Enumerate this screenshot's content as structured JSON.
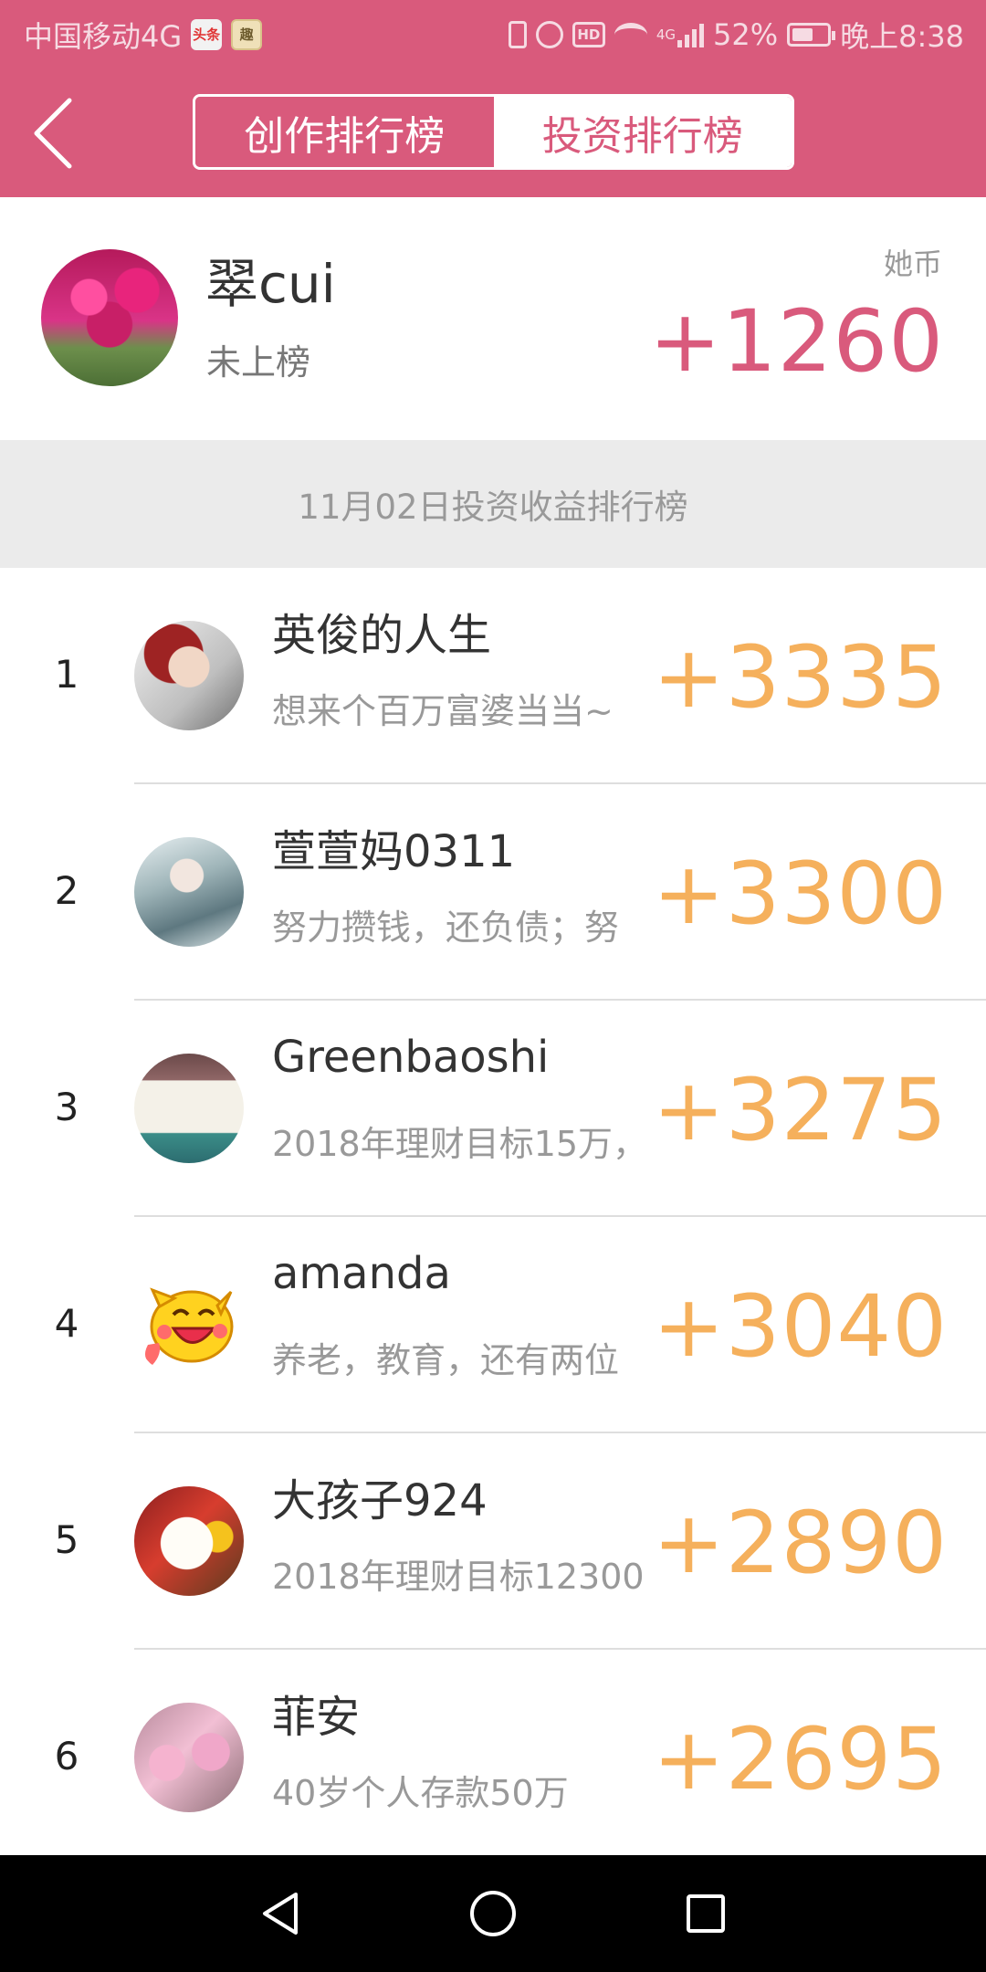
{
  "status_bar": {
    "carrier": "中国移动4G",
    "toutiao_icon": "头条",
    "app_icon": "趣",
    "hd": "HD",
    "network": "4G",
    "battery_percent": "52%",
    "battery_level": 0.52,
    "time": "晚上8:38"
  },
  "header": {
    "tabs": [
      {
        "label": "创作排行榜",
        "active": true
      },
      {
        "label": "投资排行榜",
        "active": false
      }
    ]
  },
  "me": {
    "name": "翠cui",
    "status": "未上榜",
    "coin_label": "她币",
    "score": "+1260"
  },
  "section": {
    "title": "11月02日投资收益排行榜"
  },
  "ranking": {
    "items": [
      {
        "rank": "1",
        "name": "英俊的人生",
        "motto": "想来个百万富婆当当~",
        "score": "+3335"
      },
      {
        "rank": "2",
        "name": "萱萱妈0311",
        "motto": "努力攒钱，还负债；努",
        "score": "+3300"
      },
      {
        "rank": "3",
        "name": "Greenbaoshi",
        "motto": "2018年理财目标15万，",
        "score": "+3275"
      },
      {
        "rank": "4",
        "name": "amanda",
        "motto": "养老，教育，还有两位",
        "score": "+3040"
      },
      {
        "rank": "5",
        "name": "大孩子924",
        "motto": "2018年理财目标12300",
        "score": "+2890"
      },
      {
        "rank": "6",
        "name": "菲安",
        "motto": "40岁个人存款50万",
        "score": "+2695"
      }
    ]
  },
  "icons": {
    "back": "back-arrow-icon",
    "nav_back": "nav-back-icon",
    "nav_home": "nav-home-icon",
    "nav_recent": "nav-recent-apps-icon"
  },
  "colors": {
    "brand": "#d95a7c",
    "score": "#f5b05c"
  }
}
